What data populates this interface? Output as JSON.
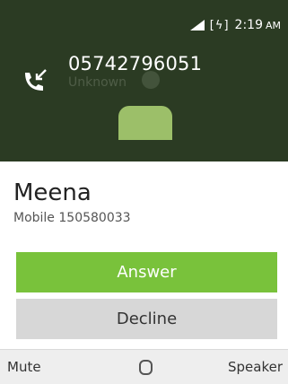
{
  "status_bar": {
    "battery": "[ϟ]",
    "time": "2:19",
    "ampm": "AM"
  },
  "call": {
    "number": "05742796051",
    "label": "Unknown"
  },
  "contact": {
    "name": "Meena",
    "detail": "Mobile 150580033"
  },
  "buttons": {
    "answer": "Answer",
    "decline": "Decline"
  },
  "softkeys": {
    "left": "Mute",
    "right": "Speaker"
  },
  "icons": {
    "signal": "signal-icon",
    "battery": "battery-charging-icon",
    "call": "incoming-call-icon",
    "avatar": "contact-avatar-icon",
    "center_key": "center-select-icon"
  },
  "colors": {
    "header_bg": "#2b3b23",
    "answer": "#79c23b",
    "decline": "#d7d7d7",
    "avatar": "#9cbf69"
  }
}
